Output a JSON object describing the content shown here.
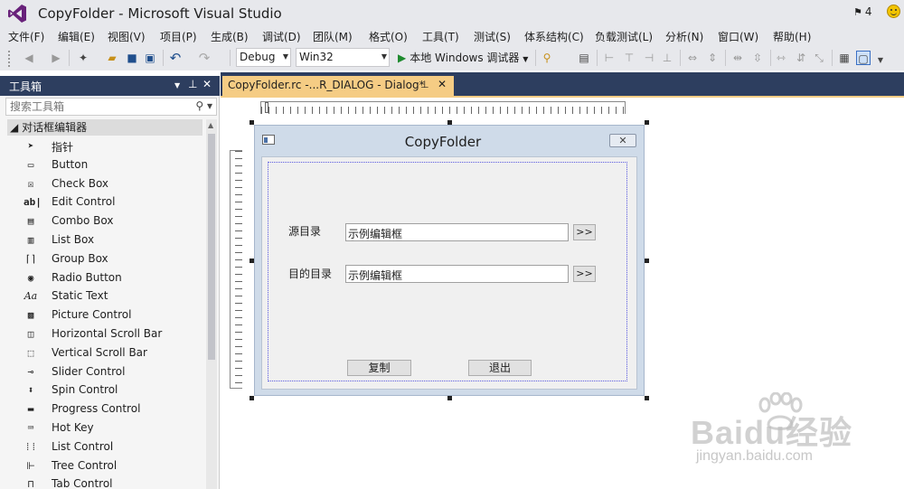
{
  "app": {
    "title": "CopyFolder - Microsoft Visual Studio",
    "notifications": "4"
  },
  "menu": [
    "文件(F)",
    "编辑(E)",
    "视图(V)",
    "项目(P)",
    "生成(B)",
    "调试(D)",
    "团队(M)",
    "格式(O)",
    "工具(T)",
    "测试(S)",
    "体系结构(C)",
    "负载测试(L)",
    "分析(N)",
    "窗口(W)",
    "帮助(H)"
  ],
  "toolbar": {
    "config": "Debug",
    "platform": "Win32",
    "run_label": "本地 Windows 调试器"
  },
  "toolbox": {
    "title": "工具箱",
    "search_placeholder": "搜索工具箱",
    "group": "对话框编辑器",
    "items": [
      {
        "label": "指针",
        "icon": "pointer-icon"
      },
      {
        "label": "Button",
        "icon": "button-icon"
      },
      {
        "label": "Check Box",
        "icon": "checkbox-icon"
      },
      {
        "label": "Edit Control",
        "icon": "edit-control-icon"
      },
      {
        "label": "Combo Box",
        "icon": "combo-box-icon"
      },
      {
        "label": "List Box",
        "icon": "list-box-icon"
      },
      {
        "label": "Group Box",
        "icon": "group-box-icon"
      },
      {
        "label": "Radio Button",
        "icon": "radio-button-icon"
      },
      {
        "label": "Static Text",
        "icon": "static-text-icon"
      },
      {
        "label": "Picture Control",
        "icon": "picture-control-icon"
      },
      {
        "label": "Horizontal Scroll Bar",
        "icon": "hscroll-icon"
      },
      {
        "label": "Vertical Scroll Bar",
        "icon": "vscroll-icon"
      },
      {
        "label": "Slider Control",
        "icon": "slider-icon"
      },
      {
        "label": "Spin Control",
        "icon": "spin-icon"
      },
      {
        "label": "Progress Control",
        "icon": "progress-icon"
      },
      {
        "label": "Hot Key",
        "icon": "hotkey-icon"
      },
      {
        "label": "List Control",
        "icon": "list-control-icon"
      },
      {
        "label": "Tree Control",
        "icon": "tree-control-icon"
      },
      {
        "label": "Tab Control",
        "icon": "tab-control-icon"
      }
    ]
  },
  "document": {
    "tab_label": "CopyFolder.rc -...R_DIALOG - Dialog*"
  },
  "dialog": {
    "title": "CopyFolder",
    "source_label": "源目录",
    "source_value": "示例编辑框",
    "dest_label": "目的目录",
    "dest_value": "示例编辑框",
    "browse_label": ">>",
    "copy_label": "复制",
    "exit_label": "退出"
  },
  "watermark": {
    "brand": "Baidu经验",
    "url": "jingyan.baidu.com"
  }
}
